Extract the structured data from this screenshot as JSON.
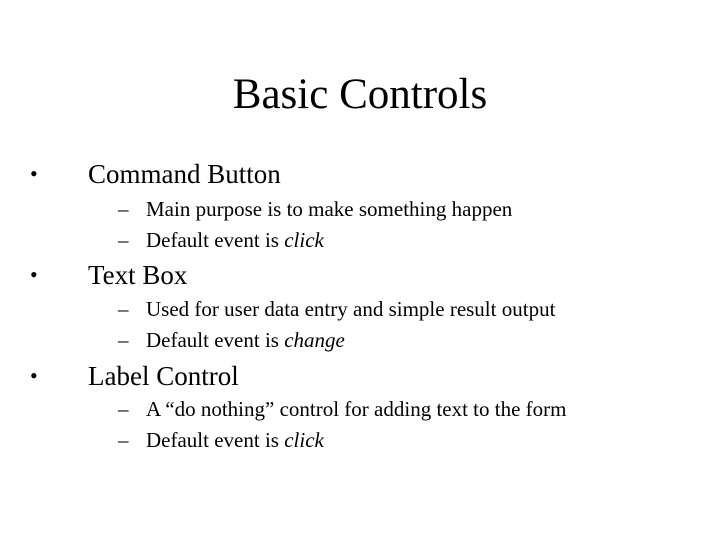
{
  "slide": {
    "title": "Basic Controls",
    "bullet_glyph": "•",
    "dash_glyph": "–",
    "sections": [
      {
        "heading": "Command Button",
        "items": [
          {
            "text": "Main purpose is to make something happen",
            "emphasis": ""
          },
          {
            "text": "Default event is ",
            "emphasis": "click"
          }
        ]
      },
      {
        "heading": "Text Box",
        "items": [
          {
            "text": "Used for user data entry and simple result output",
            "emphasis": ""
          },
          {
            "text": "Default event is ",
            "emphasis": "change"
          }
        ]
      },
      {
        "heading": "Label Control",
        "items": [
          {
            "text": "A “do nothing” control for adding text to the form",
            "emphasis": ""
          },
          {
            "text": "Default event is ",
            "emphasis": "click"
          }
        ]
      }
    ]
  }
}
